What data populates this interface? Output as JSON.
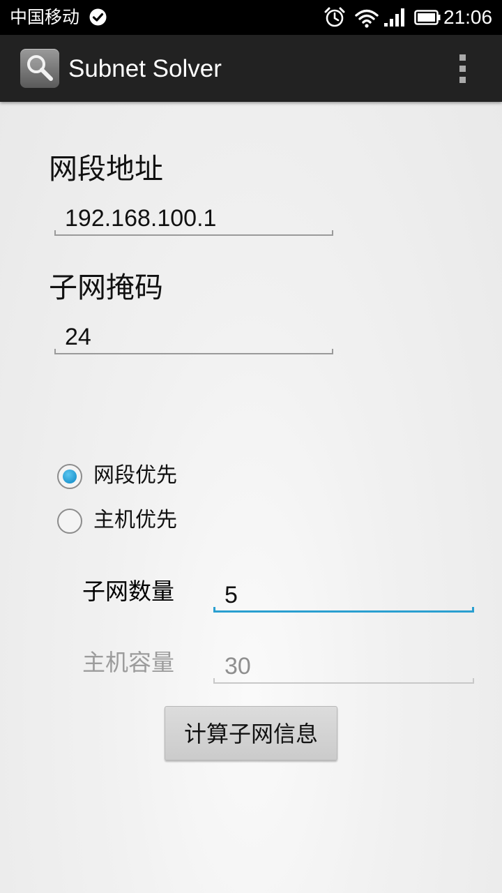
{
  "status_bar": {
    "carrier": "中国移动",
    "time": "21:06",
    "icons": [
      "check-circle-icon",
      "alarm-icon",
      "wifi-icon",
      "signal-icon",
      "battery-icon"
    ]
  },
  "action_bar": {
    "title": "Subnet Solver",
    "app_icon": "magnifier-icon",
    "overflow_icon": "overflow-menu-icon"
  },
  "form": {
    "network_address": {
      "label": "网段地址",
      "value": "192.168.100.1"
    },
    "subnet_mask": {
      "label": "子网掩码",
      "value": "24"
    },
    "priority_options": [
      {
        "label": "网段优先",
        "checked": true
      },
      {
        "label": "主机优先",
        "checked": false
      }
    ],
    "subnet_count": {
      "label": "子网数量",
      "value": "5",
      "enabled": true
    },
    "host_capacity": {
      "label": "主机容量",
      "value": "30",
      "enabled": false
    },
    "calculate_button": "计算子网信息"
  },
  "colors": {
    "accent": "#2a9fd0",
    "radio_checked": "#0a86c4",
    "action_bar": "#222222",
    "status_bar": "#000000"
  }
}
